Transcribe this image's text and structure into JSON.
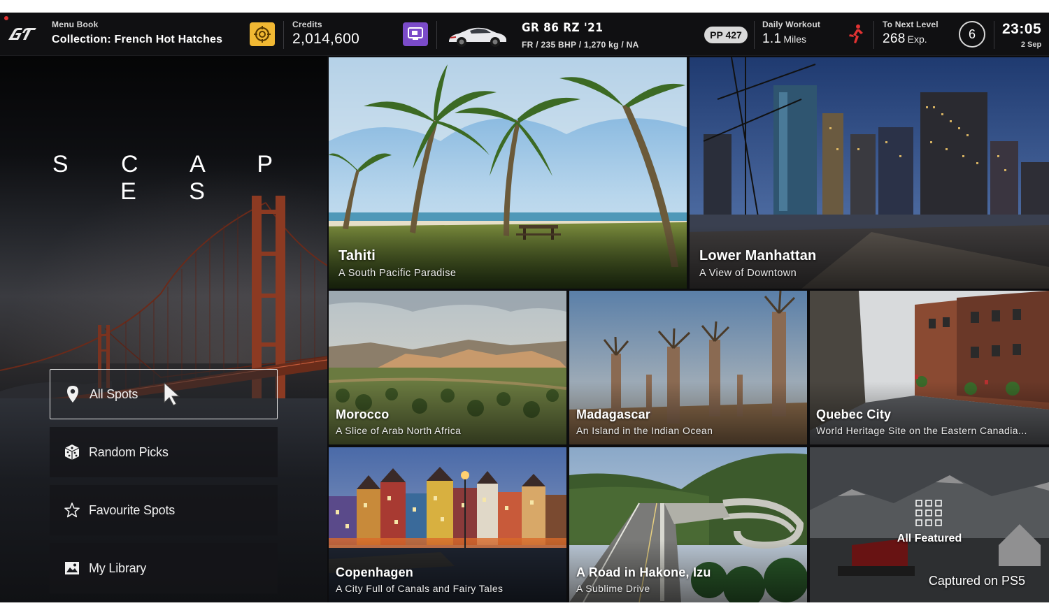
{
  "header": {
    "menu_book_label": "Menu Book",
    "menu_book_value": "Collection: French Hot Hatches",
    "credits_label": "Credits",
    "credits_value": "2,014,600",
    "car_name": "GR 86 RZ '21",
    "car_spec": "FR / 235 BHP / 1,270 kg / NA",
    "pp_badge": "PP 427",
    "daily_workout_label": "Daily Workout",
    "daily_workout_value": "1.1",
    "daily_workout_unit": "Miles",
    "next_level_label": "To Next Level",
    "next_level_value": "268",
    "next_level_unit": "Exp.",
    "level": "6",
    "time": "23:05",
    "date": "2 Sep"
  },
  "sidebar": {
    "title": "S C A P E S",
    "items": [
      {
        "label": "All Spots",
        "icon": "map-pin-icon",
        "selected": true
      },
      {
        "label": "Random Picks",
        "icon": "dice-icon",
        "selected": false
      },
      {
        "label": "Favourite Spots",
        "icon": "star-icon",
        "selected": false
      },
      {
        "label": "My Library",
        "icon": "image-icon",
        "selected": false
      }
    ]
  },
  "spots": [
    {
      "title": "Tahiti",
      "subtitle": "A South Pacific Paradise"
    },
    {
      "title": "Lower Manhattan",
      "subtitle": "A View of Downtown"
    },
    {
      "title": "Morocco",
      "subtitle": "A Slice of Arab North Africa"
    },
    {
      "title": "Madagascar",
      "subtitle": "An Island in the Indian Ocean"
    },
    {
      "title": "Quebec City",
      "subtitle": "World Heritage Site on the Eastern Canadia..."
    },
    {
      "title": "Copenhagen",
      "subtitle": "A City Full of Canals and Fairy Tales"
    },
    {
      "title": "A Road in Hakone, Izu",
      "subtitle": "A Sublime Drive"
    }
  ],
  "all_featured": {
    "label": "All Featured"
  },
  "watermark": "Captured on PS5",
  "colors": {
    "menu_icon_bg": "#f1b833",
    "gift_icon_bg": "#7b4bc9",
    "runner_icon": "#e23232",
    "rec_dot": "#e23232"
  }
}
